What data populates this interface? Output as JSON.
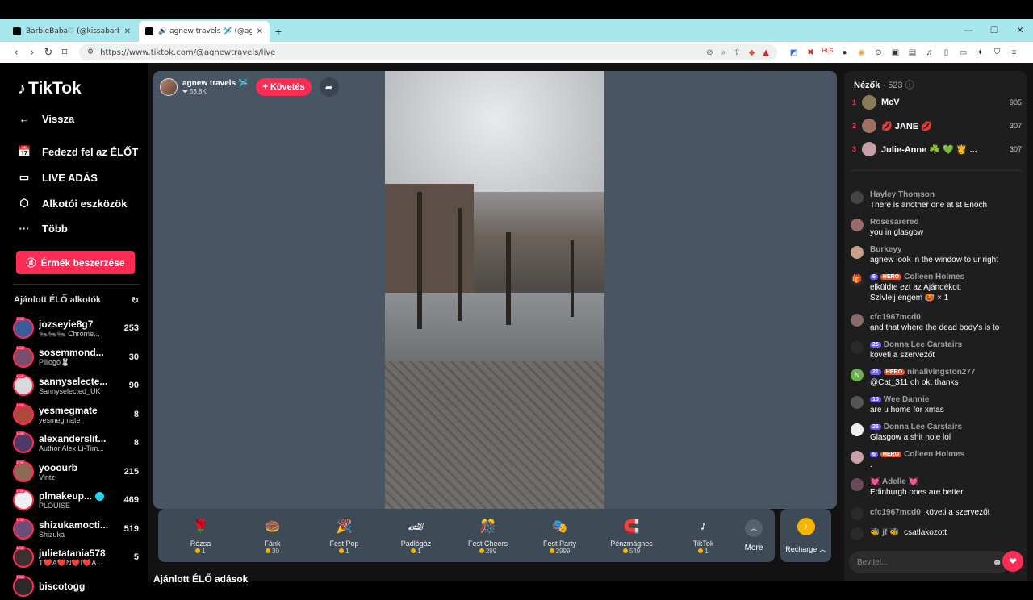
{
  "browser": {
    "tabs": [
      {
        "title": "BarbieBaba♡ (@kissabarbie) ÉLŐ at",
        "active": false
      },
      {
        "title": "🔊 agnew travels 🛩️ (@agnewtr",
        "active": true
      }
    ],
    "url": "https://www.tiktok.com/@agnewtravels/live",
    "new_tab": "+",
    "min": "—",
    "max": "❐",
    "close": "✕"
  },
  "sidebar": {
    "logo": "TikTok",
    "nav": [
      {
        "label": "Vissza",
        "icon": "←"
      },
      {
        "label": "Fedezd fel az ÉLŐT",
        "icon": "📅"
      },
      {
        "label": "LIVE ADÁS",
        "icon": "▭"
      },
      {
        "label": "Alkotói eszközök",
        "icon": "⬡"
      },
      {
        "label": "Több",
        "icon": "···"
      }
    ],
    "coins_button": "Érmék beszerzése",
    "recommended_title": "Ajánlott ÉLŐ alkotók",
    "creators": [
      {
        "name": "jozseyie8g7",
        "sub": "🐜🐜🐜 Chrome...",
        "count": "253",
        "color": "#3b5d9c"
      },
      {
        "name": "sosemmond...",
        "sub": "Pillogó🐰",
        "count": "30",
        "color": "#7a4d6d"
      },
      {
        "name": "sannyselecte...",
        "sub": "Sannyselected_UK",
        "count": "90",
        "color": "#d9d9e0"
      },
      {
        "name": "yesmegmate",
        "sub": "yesmegmate",
        "count": "8",
        "color": "#b0473b"
      },
      {
        "name": "alexanderslit...",
        "sub": "Author Alex Li-Tim...",
        "count": "8",
        "color": "#4e3a68"
      },
      {
        "name": "yooourb",
        "sub": "Vintz",
        "count": "215",
        "color": "#8c6a55"
      },
      {
        "name": "plmakeup...",
        "sub": "PLOUISE",
        "count": "469",
        "color": "#f0f0f0",
        "verified": true
      },
      {
        "name": "shizukamocti...",
        "sub": "Shizuka",
        "count": "519",
        "color": "#6b4f7a"
      },
      {
        "name": "julietatania578",
        "sub": "T❤️A❤️N❤️I❤️A...",
        "count": "5",
        "color": "#3c3030"
      },
      {
        "name": "biscotogg",
        "sub": "",
        "count": "",
        "color": "#2a2a2a"
      }
    ]
  },
  "host": {
    "name": "agnew travels 🛩️",
    "likes": "❤ 53.8K",
    "follow": "+ Követés"
  },
  "gifts": [
    {
      "name": "Rózsa",
      "price": "1",
      "icon": "🌹",
      "bg": "transparent"
    },
    {
      "name": "Fánk",
      "price": "30",
      "icon": "🍩",
      "bg": "transparent"
    },
    {
      "name": "Fest Pop",
      "price": "1",
      "icon": "🎉",
      "bg": "transparent"
    },
    {
      "name": "Padlógáz",
      "price": "1",
      "icon": "🏎",
      "bg": "transparent"
    },
    {
      "name": "Fest Cheers",
      "price": "299",
      "icon": "🎊",
      "bg": "transparent"
    },
    {
      "name": "Fest Party",
      "price": "2999",
      "icon": "🎭",
      "bg": "transparent"
    },
    {
      "name": "Pénzmágnes",
      "price": "549",
      "icon": "🧲",
      "bg": "transparent"
    },
    {
      "name": "TikTok",
      "price": "1",
      "icon": "♪",
      "bg": "transparent"
    }
  ],
  "more_label": "More",
  "more_icon": "︿",
  "recharge_label": "Recharge ︿",
  "below_title": "Ajánlott ÉLŐ adások",
  "viewers": {
    "label": "Nézők",
    "count": "· 523 ⓘ"
  },
  "top_viewers": [
    {
      "rank": "1",
      "name": "McV",
      "score": "905",
      "color": "#8a7a5a"
    },
    {
      "rank": "2",
      "name": "💋 JANE 💋",
      "score": "307",
      "color": "#a07060"
    },
    {
      "rank": "3",
      "name": "Julie-Anne ☘️ 💚 👸 ...",
      "score": "307",
      "color": "#c9a0a8"
    }
  ],
  "chat": [
    {
      "user": "Hayley Thomson",
      "text": "There is another one at st Enoch",
      "color": "#444"
    },
    {
      "user": "Rosesarered",
      "text": "you in glasgow",
      "color": "#9a6a6a"
    },
    {
      "user": "Burkeyy",
      "text": "agnew look in the window to ur right",
      "color": "#c9a08a"
    },
    {
      "user": "Colleen Holmes",
      "badges": [
        "6",
        "HERO"
      ],
      "text": "elküldte ezt az Ajándékot:",
      "text2": " Szívlelj engem 🥵 × 1",
      "color": "#2a2a2a",
      "gift": true
    },
    {
      "user": "cfc1967mcd0",
      "text": "and that where the dead body's is to",
      "color": "#8a6a6a"
    },
    {
      "user": "Donna Lee Carstairs",
      "badges": [
        "25"
      ],
      "text": "követi a szervezőt",
      "color": "#2a2a2a"
    },
    {
      "user": "ninalivingston277",
      "badges": [
        "21",
        "HERO"
      ],
      "text": "@Cat_311 oh ok, thanks",
      "color": "#6ab04c",
      "initial": "N"
    },
    {
      "user": "Wee Dannie",
      "badges": [
        "10"
      ],
      "text": "are u home for xmas",
      "color": "#555"
    },
    {
      "user": "Donna Lee Carstairs",
      "badges": [
        "25"
      ],
      "text": "Glasgow a shit hole lol",
      "color": "#eee"
    },
    {
      "user": "Colleen Holmes",
      "badges": [
        "6",
        "HERO"
      ],
      "text": ".",
      "color": "#c9a0a8"
    },
    {
      "user": "💓 Adelle 💓",
      "text": "Edinburgh ones are better",
      "color": "#6a4a5a"
    },
    {
      "user": "cfc1967mcd0",
      "inline": "követi a szervezőt",
      "color": "#2a2a2a"
    },
    {
      "user": "🐝 jf 🐝",
      "inline": "csatlakozott",
      "color": "#2a2a2a"
    }
  ],
  "chat_placeholder": "Bevitel..."
}
